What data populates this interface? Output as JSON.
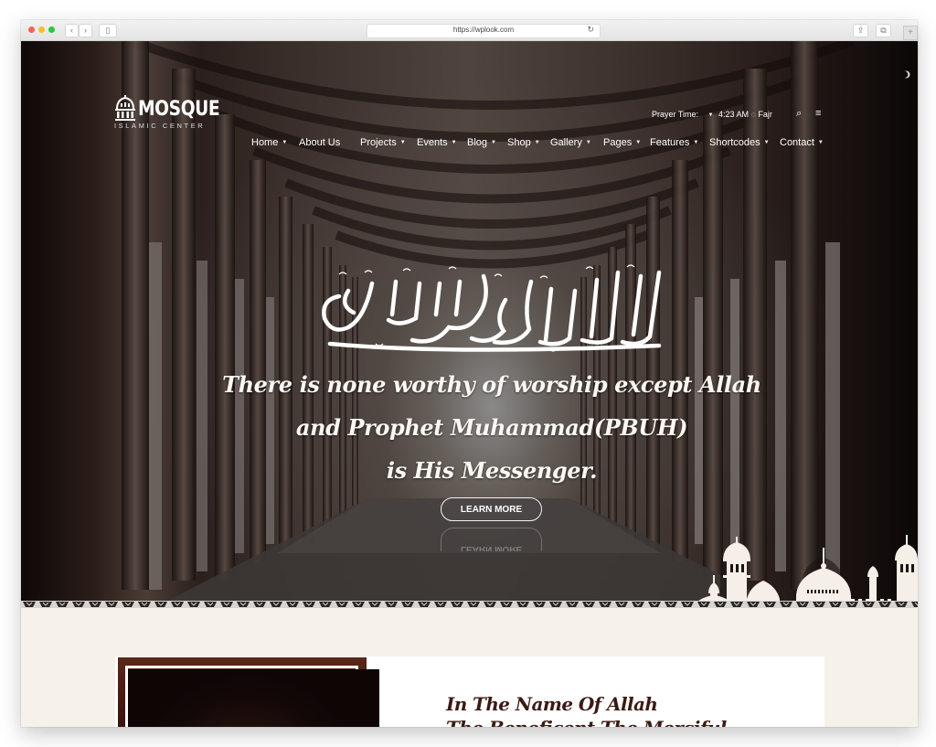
{
  "browser": {
    "url": "https://wplook.com",
    "icons": {
      "back": "chevron-left-icon",
      "forward": "chevron-right-icon",
      "sidebar": "sidebar-icon",
      "reload": "reload-icon",
      "share": "share-icon",
      "tabs": "tabs-icon",
      "new_tab": "plus-icon"
    },
    "back_glyph": "‹",
    "forward_glyph": "›",
    "sidebar_glyph": "▯",
    "reload_glyph": "↻",
    "share_glyph": "⇪",
    "tabs_glyph": "⧉",
    "plus_glyph": "+"
  },
  "site": {
    "logo": {
      "name": "MOSQUE",
      "tagline": "ISLAMIC CENTER"
    },
    "prayer": {
      "label": "Prayer Time:",
      "time": "4:23 AM",
      "name": "Fajr",
      "caret_glyph": "▼",
      "clock_glyph": "◌"
    },
    "header_icons": {
      "search_glyph": "⌕",
      "menu_glyph": "≡"
    },
    "nav": [
      {
        "label": "Home",
        "has_dropdown": true
      },
      {
        "label": "About Us",
        "has_dropdown": false
      },
      {
        "label": "Projects",
        "has_dropdown": true
      },
      {
        "label": "Events",
        "has_dropdown": true
      },
      {
        "label": "Blog",
        "has_dropdown": true
      },
      {
        "label": "Shop",
        "has_dropdown": true
      },
      {
        "label": "Gallery",
        "has_dropdown": true
      },
      {
        "label": "Pages",
        "has_dropdown": true
      },
      {
        "label": "Features",
        "has_dropdown": true
      },
      {
        "label": "Shortcodes",
        "has_dropdown": true
      },
      {
        "label": "Contact",
        "has_dropdown": true
      }
    ],
    "dropdown_glyph": "▼"
  },
  "hero": {
    "calligraphy_alt": "Shahada calligraphy",
    "lines": [
      "There is none worthy of worship except Allah",
      "and Prophet Muhammad(PBUH)",
      "is His Messenger."
    ],
    "button_label": "LEARN MORE"
  },
  "intro": {
    "title_line1": "In The Name Of Allah",
    "title_line2": "The Beneficent The Merciful"
  },
  "colors": {
    "heading": "#3b1a14",
    "page_bg": "#f7f1ec",
    "hero_text": "#fbf7f2"
  }
}
